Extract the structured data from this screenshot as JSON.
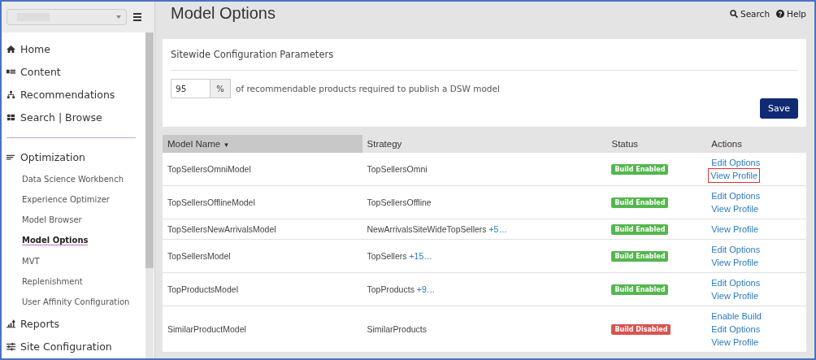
{
  "sidebar": {
    "nav": [
      {
        "label": "Home"
      },
      {
        "label": "Content"
      },
      {
        "label": "Recommendations"
      },
      {
        "label": "Search | Browse"
      },
      {
        "label": "Optimization",
        "divider_before": true,
        "children": [
          {
            "label": "Data Science Workbench",
            "selected": false
          },
          {
            "label": "Experience Optimizer",
            "selected": false
          },
          {
            "label": "Model Browser",
            "selected": false
          },
          {
            "label": "Model Options",
            "selected": true
          },
          {
            "label": "MVT",
            "selected": false
          },
          {
            "label": "Replenishment",
            "selected": false
          },
          {
            "label": "User Affinity Configuration",
            "selected": false
          }
        ]
      },
      {
        "label": "Reports"
      },
      {
        "label": "Site Configuration"
      }
    ]
  },
  "header": {
    "title": "Model Options",
    "links": [
      "Search",
      "Help"
    ]
  },
  "config": {
    "title": "Sitewide Configuration Parameters",
    "value": "95",
    "unit": "%",
    "description": "of recommendable products required to publish a DSW model",
    "button": "Save"
  },
  "table": {
    "columns": [
      {
        "label": "Model Name",
        "sort": "▼",
        "selected": true
      },
      {
        "label": "Strategy",
        "selected": false
      },
      {
        "label": "Status",
        "selected": false
      },
      {
        "label": "Actions",
        "selected": false
      }
    ],
    "rows": [
      {
        "name": "TopSellersOmniModel",
        "strategy": "TopSellersOmni",
        "status": {
          "label": "Build Enabled",
          "color": "#55b64f"
        },
        "actions": [
          {
            "label": "Edit Options",
            "highlighted": false
          },
          {
            "label": "View Profile",
            "highlighted": true
          }
        ]
      },
      {
        "name": "TopSellersOfflineModel",
        "strategy": "TopSellersOffline",
        "status": {
          "label": "Build Enabled",
          "color": "#55b64f"
        },
        "actions": [
          {
            "label": "Edit Options",
            "highlighted": false
          },
          {
            "label": "View Profile",
            "highlighted": false
          }
        ]
      },
      {
        "name": "TopSellersNewArrivalsModel",
        "strategy": "NewArrivalsSiteWideTopSellers",
        "more": "+5…",
        "status": {
          "label": "Build Enabled",
          "color": "#55b64f"
        },
        "actions": [
          {
            "label": "View Profile",
            "highlighted": false
          }
        ]
      },
      {
        "name": "TopSellersModel",
        "strategy": "TopSellers",
        "more": "+15…",
        "status": {
          "label": "Build Enabled",
          "color": "#55b64f"
        },
        "actions": [
          {
            "label": "Edit Options",
            "highlighted": false
          },
          {
            "label": "View Profile",
            "highlighted": false
          }
        ]
      },
      {
        "name": "TopProductsModel",
        "strategy": "TopProducts",
        "more": "+9…",
        "status": {
          "label": "Build Enabled",
          "color": "#55b64f"
        },
        "actions": [
          {
            "label": "Edit Options",
            "highlighted": false
          },
          {
            "label": "View Profile",
            "highlighted": false
          }
        ]
      },
      {
        "name": "SimilarProductModel",
        "strategy": "SimilarProducts",
        "status": {
          "label": "Build Disabled",
          "color": "#d9534f"
        },
        "actions": [
          {
            "label": "Enable Build",
            "highlighted": false
          },
          {
            "label": "Edit Options",
            "highlighted": false
          },
          {
            "label": "View Profile",
            "highlighted": false
          }
        ]
      }
    ]
  }
}
